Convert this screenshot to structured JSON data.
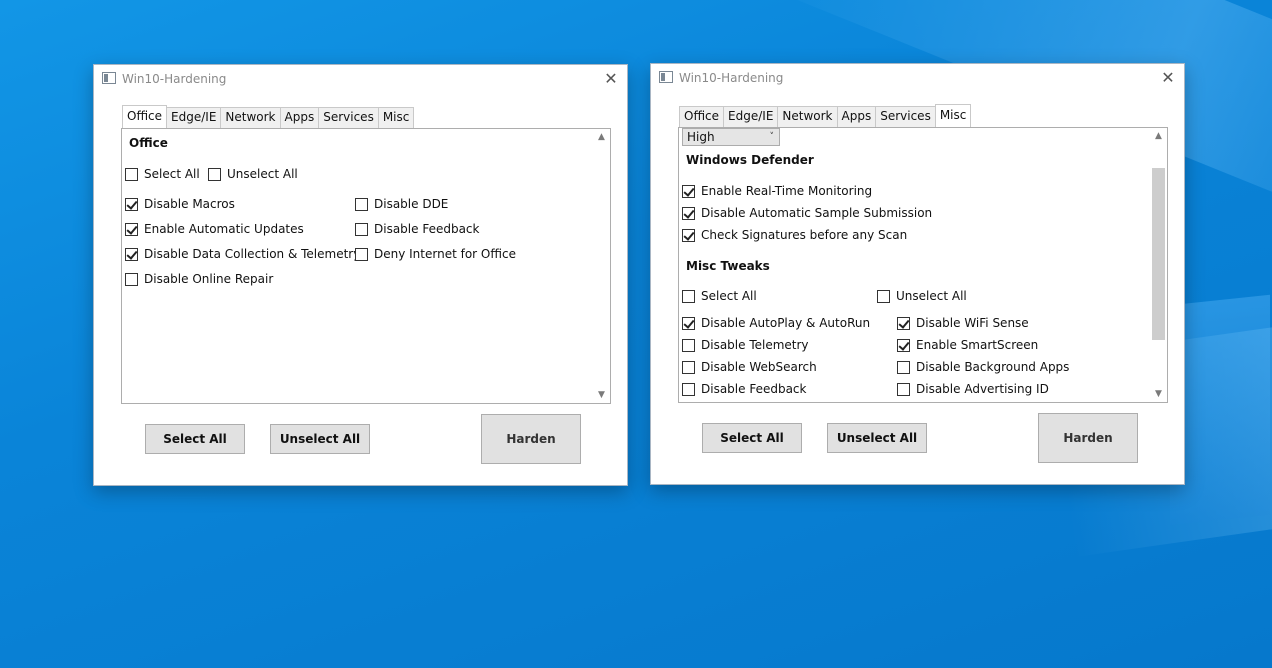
{
  "desktop": {
    "accent": "#0a84d8"
  },
  "window1": {
    "title": "Win10-Hardening",
    "close_icon": "✕",
    "tabs": [
      "Office",
      "Edge/IE",
      "Network",
      "Apps",
      "Services",
      "Misc"
    ],
    "active_tab": "Office",
    "section_title": "Office",
    "select_all": "Select All",
    "unselect_all": "Unselect All",
    "options": [
      {
        "label": "Disable Macros",
        "checked": true
      },
      {
        "label": "Enable Automatic Updates",
        "checked": true
      },
      {
        "label": "Disable Data Collection & Telemetry",
        "checked": true
      },
      {
        "label": "Disable Online Repair",
        "checked": false
      },
      {
        "label": "Disable DDE",
        "checked": false
      },
      {
        "label": "Disable Feedback",
        "checked": false
      },
      {
        "label": "Deny Internet for Office",
        "checked": false
      }
    ],
    "buttons": {
      "select_all": "Select All",
      "unselect_all": "Unselect All",
      "harden": "Harden"
    }
  },
  "window2": {
    "title": "Win10-Hardening",
    "close_icon": "✕",
    "tabs": [
      "Office",
      "Edge/IE",
      "Network",
      "Apps",
      "Services",
      "Misc"
    ],
    "active_tab": "Misc",
    "combo_value": "High",
    "defender_title": "Windows Defender",
    "defender_options": [
      {
        "label": "Enable Real-Time Monitoring",
        "checked": true
      },
      {
        "label": "Disable Automatic Sample Submission",
        "checked": true
      },
      {
        "label": "Check Signatures before any Scan",
        "checked": true
      }
    ],
    "tweaks_title": "Misc Tweaks",
    "select_all": "Select All",
    "unselect_all": "Unselect All",
    "tweaks": [
      {
        "label": "Disable AutoPlay & AutoRun",
        "checked": true
      },
      {
        "label": "Disable Telemetry",
        "checked": false
      },
      {
        "label": "Disable WebSearch",
        "checked": false
      },
      {
        "label": "Disable Feedback",
        "checked": false
      },
      {
        "label": "Disable WiFi Sense",
        "checked": true
      },
      {
        "label": "Enable SmartScreen",
        "checked": true
      },
      {
        "label": "Disable Background Apps",
        "checked": false
      },
      {
        "label": "Disable Advertising ID",
        "checked": false
      }
    ],
    "buttons": {
      "select_all": "Select All",
      "unselect_all": "Unselect All",
      "harden": "Harden"
    }
  }
}
